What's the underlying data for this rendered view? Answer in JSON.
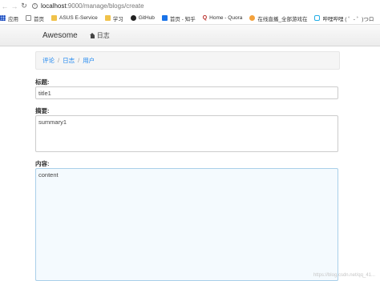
{
  "browser": {
    "url_host": "localhost",
    "url_rest": ":9000/manage/blogs/create",
    "bookmarks": [
      {
        "label": "应用",
        "icon": "apps-grid-icon"
      },
      {
        "label": "首页",
        "icon": "page-icon"
      },
      {
        "label": "ASUS E-Service",
        "icon": "folder-icon"
      },
      {
        "label": "学习",
        "icon": "folder-icon"
      },
      {
        "label": "GitHub",
        "icon": "github-icon"
      },
      {
        "label": "首页 - 知乎",
        "icon": "zhihu-icon"
      },
      {
        "label": "Home - Quora",
        "icon": "quora-icon"
      },
      {
        "label": "在线直播_全部游戏在",
        "icon": "game-icon"
      },
      {
        "label": "哔哩哔哩 ( ゜- ゜)つロ",
        "icon": "bilibili-icon"
      }
    ]
  },
  "navbar": {
    "brand": "Awesome",
    "link_label": "日志"
  },
  "breadcrumb": {
    "items": [
      "评论",
      "日志",
      "用户"
    ],
    "separator": "/"
  },
  "form": {
    "title_label": "标题:",
    "title_value": "title1",
    "summary_label": "摘要:",
    "summary_value": "summary1",
    "content_label": "内容:",
    "content_value": "content"
  },
  "watermark": "https://blog.csdn.net/qq_41..."
}
